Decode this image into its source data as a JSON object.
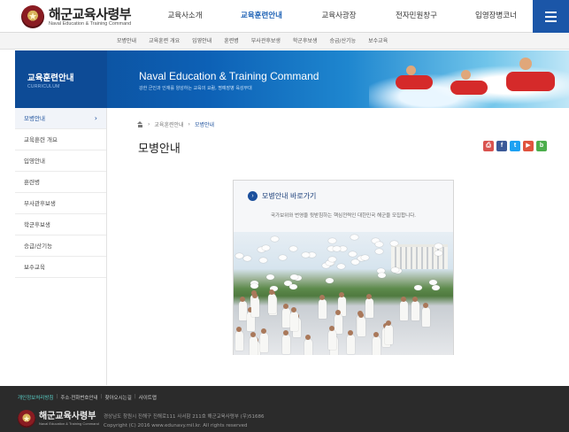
{
  "header": {
    "logo_ko": "해군교육사령부",
    "logo_en": "Naval Education & Training Command",
    "gnb": [
      "교육사소개",
      "교육훈련안내",
      "교육사광장",
      "전자민원창구",
      "입영장병코너"
    ],
    "gnb_active": 1
  },
  "subnav": [
    "모병안내",
    "교육훈련 개요",
    "입영안내",
    "훈련병",
    "부사관후보생",
    "학군후보생",
    "승급/산기능",
    "보수교육"
  ],
  "banner": {
    "side_title": "교육훈련안내",
    "side_sub": "CURRICULUM",
    "title": "Naval Education & Training Command",
    "subtitle": "강한 군인과 인재를 양성하는 교육의 요람, 명예장병 육성부대"
  },
  "lnb": {
    "items": [
      "모병안내",
      "교육훈련 개요",
      "입영안내",
      "훈련병",
      "부사관후보생",
      "학군후보생",
      "승급/산기능",
      "보수교육"
    ],
    "active": 0,
    "arrow": "›"
  },
  "breadcrumb": [
    "교육훈련안내",
    "모병안내"
  ],
  "page_title": "모병안내",
  "share_icons": [
    {
      "icon": "print-icon",
      "glyph": "⎙",
      "color": "#d9534f"
    },
    {
      "icon": "facebook-icon",
      "glyph": "f",
      "color": "#3b5998"
    },
    {
      "icon": "twitter-icon",
      "glyph": "t",
      "color": "#1da1f2"
    },
    {
      "icon": "youtube-icon",
      "glyph": "▶",
      "color": "#e0533e"
    },
    {
      "icon": "blog-icon",
      "glyph": "b",
      "color": "#4cae4c"
    }
  ],
  "card": {
    "icon_glyph": "›",
    "title": "모병안내 바로가기",
    "desc": "국가보위와 번영을 뒷받침하는 핵심전력인 대한민국 해군을 모집합니다."
  },
  "footer": {
    "links": [
      "개인정보처리방침",
      "주소·전화번호안내",
      "찾아오시는길",
      "사이트맵"
    ],
    "logo_ko": "해군교육사령부",
    "logo_en": "Naval Education & Training Command",
    "address": "경상남도 창원시 진해구 진해로111 사서함 211호 해군교육사령부 (우)51686",
    "copyright": "Copyright (C) 2016 www.edunavy.mil.kr. All rights reserved"
  }
}
